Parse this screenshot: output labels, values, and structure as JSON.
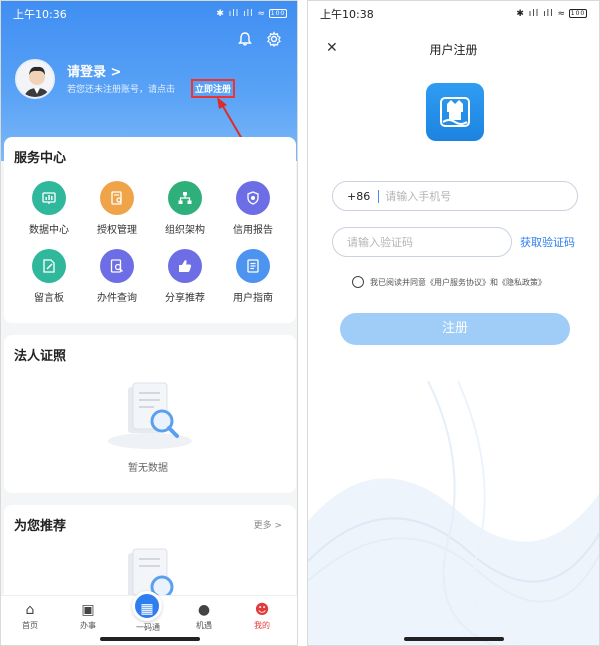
{
  "left": {
    "status": {
      "time": "上午10:36",
      "icons": "✱ ıll ıll ≈",
      "battery": "100"
    },
    "header": {
      "login_label": "请登录 >",
      "hint_text": "若您还未注册账号，请点击",
      "register_link": "立即注册"
    },
    "services": {
      "title": "服务中心",
      "items": [
        {
          "label": "数据中心",
          "icon": "chart-icon",
          "color": "#2fb89b"
        },
        {
          "label": "授权管理",
          "icon": "key-doc-icon",
          "color": "#f0a44a"
        },
        {
          "label": "组织架构",
          "icon": "org-icon",
          "color": "#2fb07a"
        },
        {
          "label": "信用报告",
          "icon": "shield-icon",
          "color": "#6d6ee6"
        },
        {
          "label": "留言板",
          "icon": "edit-icon",
          "color": "#2fb89b"
        },
        {
          "label": "办件查询",
          "icon": "search-doc-icon",
          "color": "#6d6ee6"
        },
        {
          "label": "分享推荐",
          "icon": "thumb-icon",
          "color": "#6d6ee6"
        },
        {
          "label": "用户指南",
          "icon": "guide-icon",
          "color": "#4d94f0"
        }
      ]
    },
    "license": {
      "title": "法人证照",
      "empty_text": "暂无数据"
    },
    "recommend": {
      "title": "为您推荐",
      "more": "更多 >"
    },
    "nav": [
      {
        "label": "首页",
        "icon": "home-icon"
      },
      {
        "label": "办事",
        "icon": "briefcase-icon"
      },
      {
        "label": "一码通",
        "icon": "qr-icon"
      },
      {
        "label": "机遇",
        "icon": "bulb-icon"
      },
      {
        "label": "我的",
        "icon": "user-icon"
      }
    ]
  },
  "right": {
    "status": {
      "time": "上午10:38",
      "icons": "✱ ıll ıll ≈",
      "battery": "100"
    },
    "title": "用户注册",
    "phone": {
      "prefix": "+86",
      "placeholder": "请输入手机号"
    },
    "code": {
      "placeholder": "请输入验证码",
      "get_code": "获取验证码"
    },
    "agreement": "我已阅读并同意《用户服务协议》和《隐私政策》",
    "register_button": "注册"
  },
  "colors": {
    "primary": "#3f8ef2",
    "button_disabled": "#9fcdf8",
    "link": "#2f7ef0",
    "highlight": "#e23b3b"
  }
}
